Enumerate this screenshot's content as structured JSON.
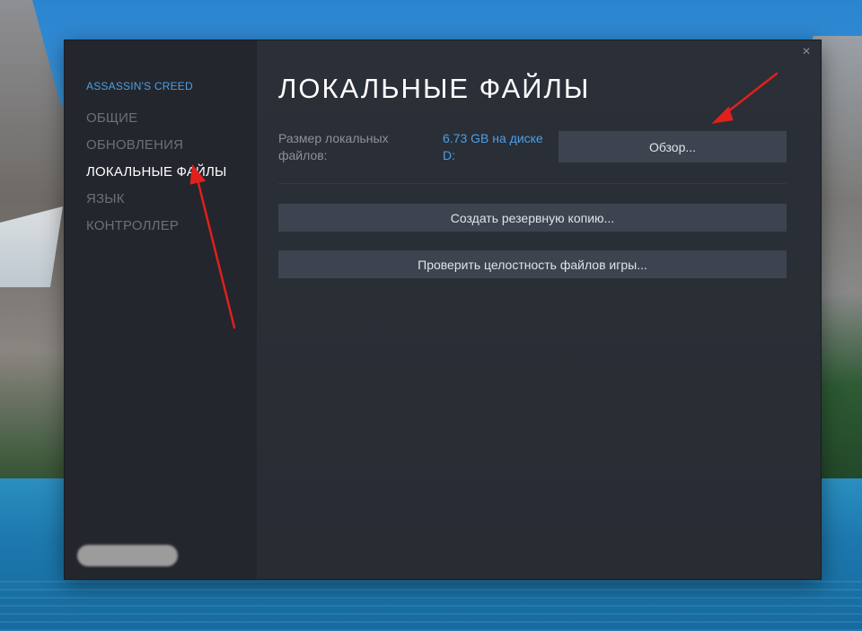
{
  "dialog": {
    "close_glyph": "×",
    "sidebar": {
      "game_title": "ASSASSIN'S CREED",
      "items": [
        {
          "label": "ОБЩИЕ",
          "active": false
        },
        {
          "label": "ОБНОВЛЕНИЯ",
          "active": false
        },
        {
          "label": "ЛОКАЛЬНЫЕ ФАЙЛЫ",
          "active": true
        },
        {
          "label": "ЯЗЫК",
          "active": false
        },
        {
          "label": "КОНТРОЛЛЕР",
          "active": false
        }
      ]
    },
    "content": {
      "title": "ЛОКАЛЬНЫЕ ФАЙЛЫ",
      "size_label": "Размер локальных файлов:",
      "size_value": "6.73 GB на диске D:",
      "browse_button": "Обзор...",
      "backup_button": "Создать резервную копию...",
      "verify_button": "Проверить целостность файлов игры..."
    }
  },
  "colors": {
    "accent": "#4c9fe8",
    "annotation_arrow": "#e0201c",
    "button_bg": "#3d4450"
  }
}
